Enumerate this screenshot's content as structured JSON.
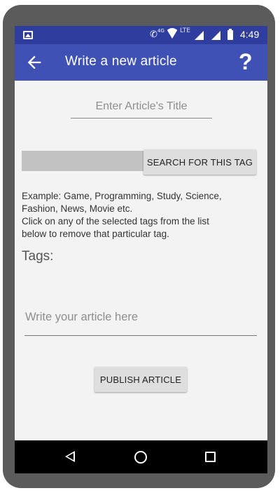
{
  "status_bar": {
    "network_4g": "4G",
    "network_lte": "LTE",
    "time": "4:49"
  },
  "app_bar": {
    "title": "Write a new article",
    "help_label": "?"
  },
  "form": {
    "title_placeholder": "Enter Article's Title",
    "tag_input_value": "",
    "search_tag_button": "SEARCH FOR THIS TAG",
    "hint_line1": "Example: Game, Programming, Study, Science,",
    "hint_line2": "Fashion, News, Movie etc.",
    "hint_line3": "Click on any of the selected tags from the list",
    "hint_line4": "below to remove that particular tag.",
    "tags_label": "Tags:",
    "article_placeholder": "Write your article here",
    "publish_button": "PUBLISH ARTICLE"
  },
  "colors": {
    "app_bar": "#3f51b5",
    "status_bar": "#2f3e9e",
    "background": "#f3f3f3",
    "button": "#dedede"
  }
}
